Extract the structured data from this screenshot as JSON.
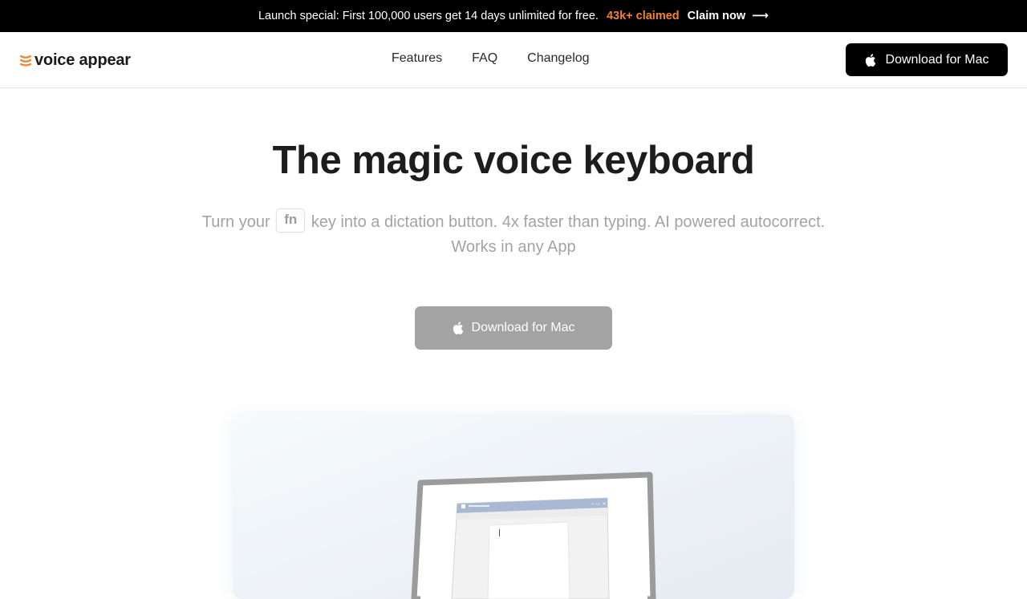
{
  "announcement": {
    "text": "Launch special: First 100,000 users get 14 days unlimited for free.",
    "claimed": "43k+ claimed",
    "claim_link": "Claim now",
    "arrow": "⟶"
  },
  "brand": {
    "name": "voice appear",
    "icon": "voice-waves-icon",
    "accent_color": "#f2832e"
  },
  "nav": {
    "links": [
      "Features",
      "FAQ",
      "Changelog"
    ],
    "cta": "Download for Mac",
    "cta_icon": "apple-icon"
  },
  "hero": {
    "title": "The magic voice keyboard",
    "subtitle_before": "Turn your",
    "key": "fn",
    "subtitle_after": "key into a dictation button. 4x faster than typing. AI powered autocorrect. Works in any App",
    "cta": "Download for Mac",
    "cta_icon": "apple-icon"
  },
  "demo": {
    "illustration": "laptop-illustration"
  }
}
